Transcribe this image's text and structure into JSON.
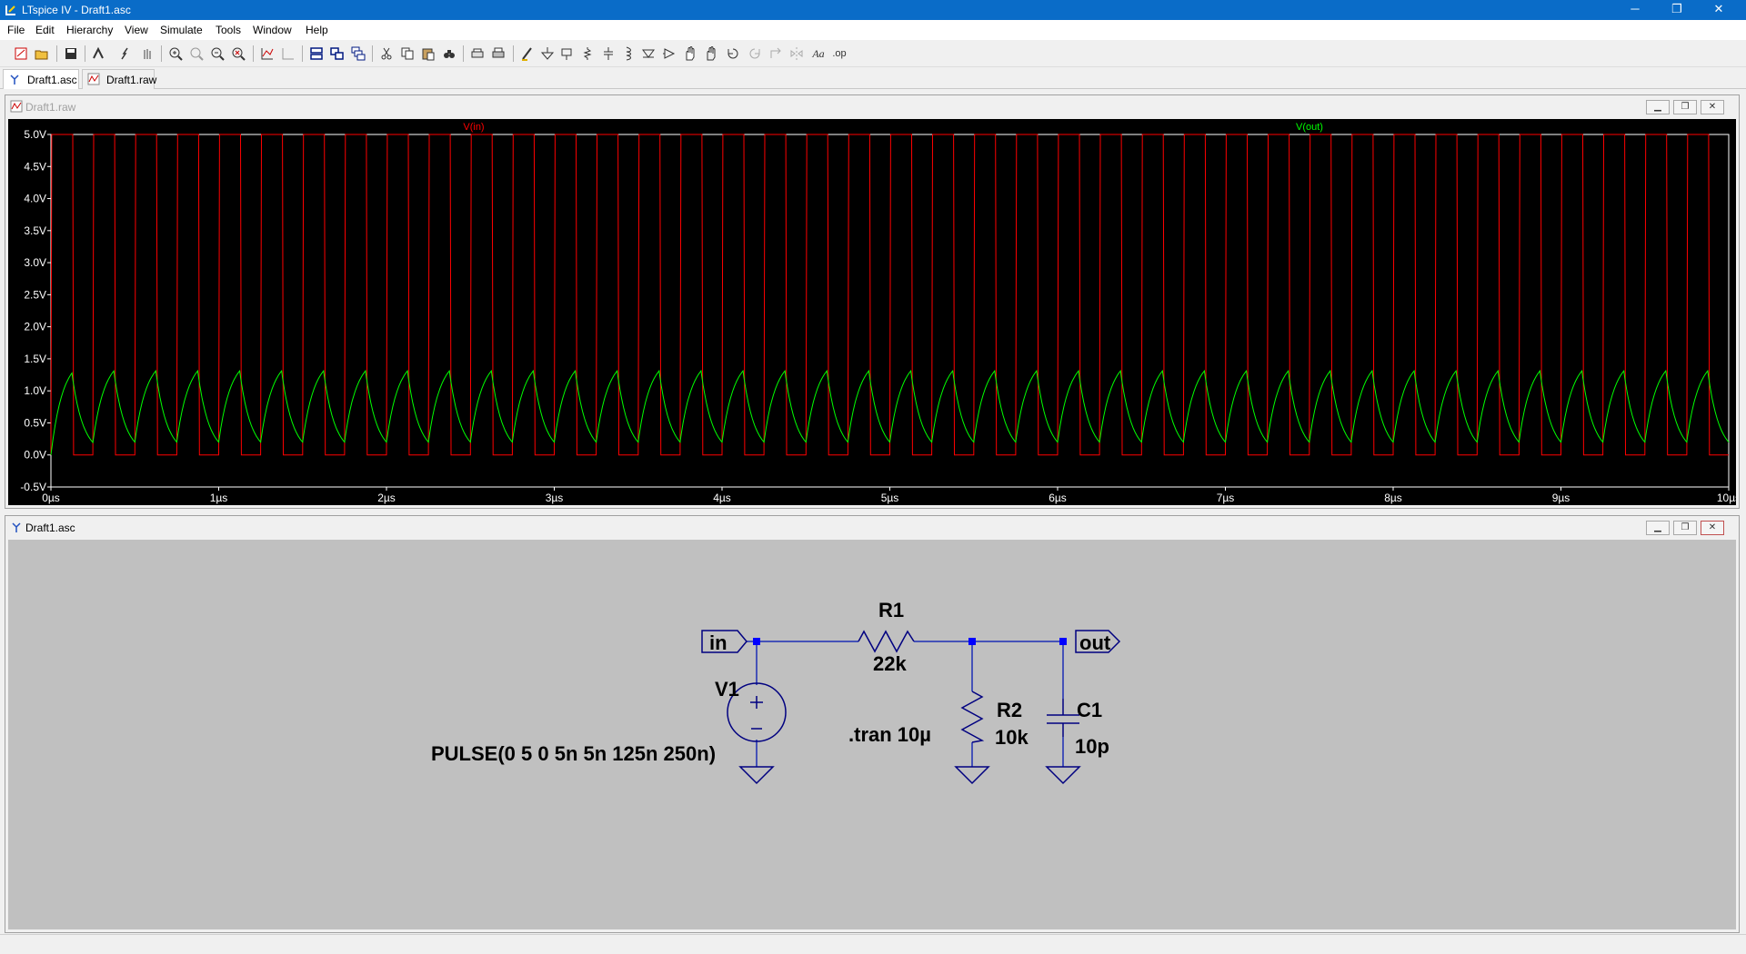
{
  "app": {
    "title": "LTspice IV - Draft1.asc"
  },
  "window_controls": {
    "minimize": "─",
    "restore": "❐",
    "close": "✕"
  },
  "menu": [
    "File",
    "Edit",
    "Hierarchy",
    "View",
    "Simulate",
    "Tools",
    "Window",
    "Help"
  ],
  "toolbar_icons": [
    "new-schematic-icon",
    "open-icon",
    "save-icon",
    "control-panel-icon",
    "run-icon",
    "halt-icon",
    "zoom-in-icon",
    "zoom-out-icon",
    "zoom-fit-icon",
    "zoom-cancel-icon",
    "autorange-icon",
    "grid-icon",
    "tile-horizontal-icon",
    "tile-vertical-icon",
    "cascade-icon",
    "cut-icon",
    "copy-icon",
    "paste-icon",
    "find-icon",
    "print-setup-icon",
    "print-icon",
    "draw-wire-icon",
    "ground-icon",
    "label-net-icon",
    "resistor-icon",
    "capacitor-icon",
    "inductor-icon",
    "diode-icon",
    "component-icon",
    "move-icon",
    "drag-icon",
    "undo-icon",
    "redo-icon",
    "rotate-icon",
    "mirror-icon",
    "text-icon",
    "spice-directive-icon"
  ],
  "tabs": [
    {
      "label": "Draft1.asc",
      "icon": "schematic-icon",
      "active": true
    },
    {
      "label": "Draft1.raw",
      "icon": "waveform-icon",
      "active": false
    }
  ],
  "plot_window": {
    "title": "Draft1.raw"
  },
  "schematic_window": {
    "title": "Draft1.asc"
  },
  "chart_data": {
    "type": "line",
    "x_unit": "µs",
    "xlim": [
      0,
      10
    ],
    "ylim": [
      -0.5,
      5.0
    ],
    "x_ticks": [
      "0µs",
      "1µs",
      "2µs",
      "3µs",
      "4µs",
      "5µs",
      "6µs",
      "7µs",
      "8µs",
      "9µs",
      "10µs"
    ],
    "y_ticks": [
      "5.0V",
      "4.5V",
      "4.0V",
      "3.5V",
      "3.0V",
      "2.5V",
      "2.0V",
      "1.5V",
      "1.0V",
      "0.5V",
      "0.0V",
      "-0.5V"
    ],
    "grid": false,
    "series": [
      {
        "name": "V(in)",
        "color": "#ff0000",
        "kind": "pulse",
        "low": 0,
        "high": 5,
        "delay_us": 0,
        "rise_us": 0.005,
        "fall_us": 0.005,
        "width_us": 0.125,
        "period_us": 0.25
      },
      {
        "name": "V(out)",
        "color": "#00ff00",
        "kind": "rc_response",
        "steady_max": 1.32,
        "steady_min": 0.25,
        "start": 0
      }
    ]
  },
  "schematic": {
    "components": [
      {
        "ref": "V1",
        "value": "PULSE(0 5 0 5n 5n 125n 250n)"
      },
      {
        "ref": "R1",
        "value": "22k"
      },
      {
        "ref": "R2",
        "value": "10k"
      },
      {
        "ref": "C1",
        "value": "10p"
      }
    ],
    "net_labels": [
      "in",
      "out"
    ],
    "directive": ".tran 10µ"
  }
}
